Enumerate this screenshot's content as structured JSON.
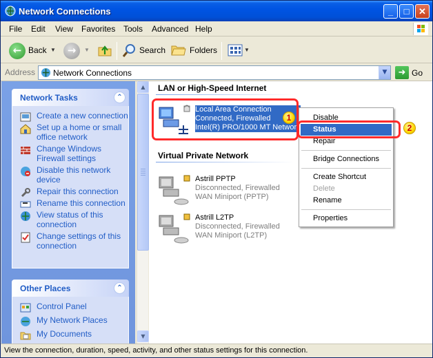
{
  "window": {
    "title": "Network Connections"
  },
  "titlebar_buttons": {
    "minimize": "_",
    "maximize": "□",
    "close": "✕"
  },
  "menu": [
    "File",
    "Edit",
    "View",
    "Favorites",
    "Tools",
    "Advanced",
    "Help"
  ],
  "toolbar": {
    "back": "Back",
    "search": "Search",
    "folders": "Folders"
  },
  "address": {
    "label": "Address",
    "value": "Network Connections",
    "go": "Go"
  },
  "network_tasks": {
    "title": "Network Tasks",
    "items": [
      {
        "label": "Create a new connection",
        "icon": "new-connection-icon"
      },
      {
        "label": "Set up a home or small office network",
        "icon": "home-network-icon"
      },
      {
        "label": "Change Windows Firewall settings",
        "icon": "firewall-icon"
      },
      {
        "label": "Disable this network device",
        "icon": "disable-device-icon"
      },
      {
        "label": "Repair this connection",
        "icon": "repair-icon"
      },
      {
        "label": "Rename this connection",
        "icon": "rename-icon"
      },
      {
        "label": "View status of this connection",
        "icon": "status-icon"
      },
      {
        "label": "Change settings of this connection",
        "icon": "settings-icon"
      }
    ]
  },
  "other_places": {
    "title": "Other Places",
    "items": [
      {
        "label": "Control Panel",
        "icon": "control-panel-icon"
      },
      {
        "label": "My Network Places",
        "icon": "network-places-icon"
      },
      {
        "label": "My Documents",
        "icon": "documents-icon"
      }
    ]
  },
  "groups": {
    "lan": {
      "title": "LAN or High-Speed Internet",
      "connections": [
        {
          "name": "Local Area Connection",
          "status": "Connected, Firewalled",
          "device": "Intel(R) PRO/1000 MT Network"
        }
      ]
    },
    "vpn": {
      "title": "Virtual Private Network",
      "connections": [
        {
          "name": "Astrill PPTP",
          "status": "Disconnected, Firewalled",
          "device": "WAN Miniport (PPTP)"
        },
        {
          "name": "Astrill L2TP",
          "status": "Disconnected, Firewalled",
          "device": "WAN Miniport (L2TP)"
        }
      ]
    }
  },
  "context_menu": {
    "items": [
      {
        "label": "Disable",
        "state": "normal"
      },
      {
        "label": "Status",
        "state": "highlighted"
      },
      {
        "label": "Repair",
        "state": "normal"
      },
      {
        "label": "Bridge Connections",
        "state": "normal"
      },
      {
        "label": "Create Shortcut",
        "state": "normal"
      },
      {
        "label": "Delete",
        "state": "disabled"
      },
      {
        "label": "Rename",
        "state": "normal"
      },
      {
        "label": "Properties",
        "state": "normal"
      }
    ]
  },
  "annotations": {
    "step1": "1",
    "step2": "2",
    "color": "#ff2a2a"
  },
  "status_bar": "View the connection, duration, speed, activity, and other status settings for this connection.",
  "colors": {
    "titlebar": "#0054e3",
    "selection": "#316ac5",
    "task_link": "#215dc6",
    "left_pane": "#7aa1e6"
  }
}
